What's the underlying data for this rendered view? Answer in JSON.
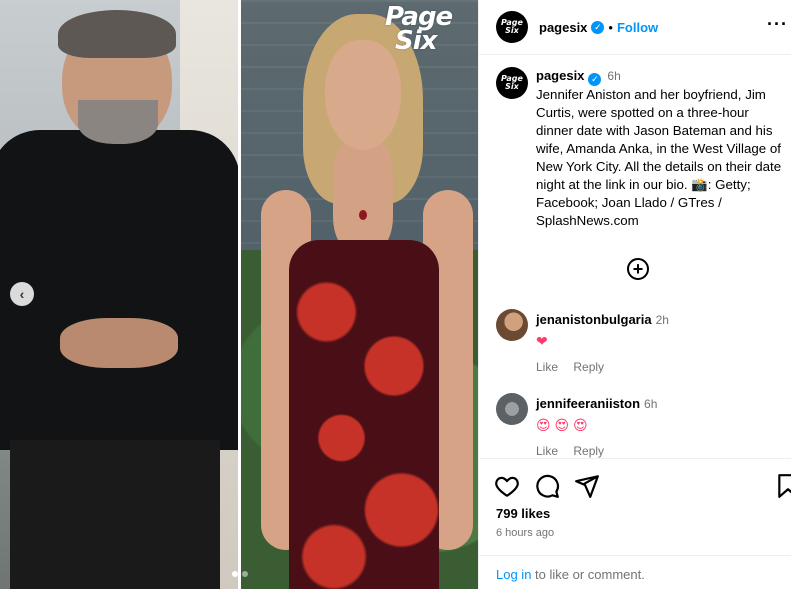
{
  "media": {
    "watermark_line1": "Page",
    "watermark_line2": "Six",
    "carousel_prev_glyph": "‹",
    "dots_count": 2
  },
  "header": {
    "avatar_text_1": "Page",
    "avatar_text_2": "Six",
    "username": "pagesix",
    "verified_glyph": "✓",
    "separator": "•",
    "follow_label": "Follow",
    "more_glyph": "···"
  },
  "caption": {
    "username": "pagesix",
    "time": "6h",
    "text": "Jennifer Aniston and her boyfriend, Jim Curtis, were spotted on a three-hour dinner date with Jason Bateman and his wife, Amanda Anka, in the West Village of New York City. All the details on their date night at the link in our bio. 📸: Getty; Facebook; Joan Llado / GTres / SplashNews.com"
  },
  "add_comment_glyph": "+",
  "comments": [
    {
      "username": "jenanistonbulgaria",
      "time": "2h",
      "text": "❤",
      "like_label": "Like",
      "reply_label": "Reply"
    },
    {
      "username": "jennifeeraniiston",
      "time": "6h",
      "text": "😍 😍 😍",
      "like_label": "Like",
      "reply_label": "Reply"
    }
  ],
  "actions": {
    "icons": [
      "heart-icon",
      "comment-icon",
      "share-icon",
      "bookmark-icon"
    ]
  },
  "likes": "799 likes",
  "time_ago": "6 hours ago",
  "login": {
    "link_label": "Log in",
    "suffix": " to like or comment."
  },
  "colors": {
    "accent": "#0095f6",
    "muted": "#737373",
    "heart_emoji": "#ff3b6b"
  }
}
